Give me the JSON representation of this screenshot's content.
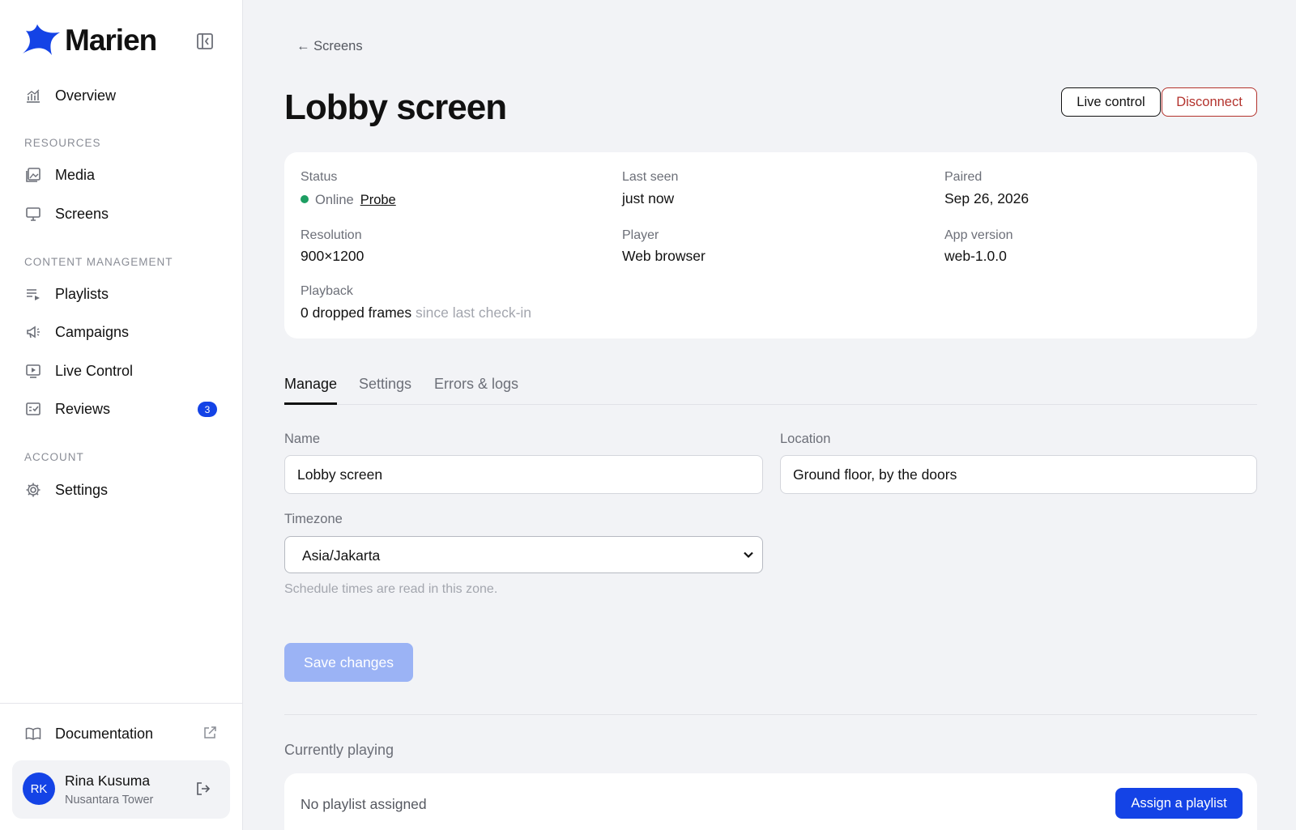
{
  "brand": {
    "name": "Marien",
    "accent": "#1443e6"
  },
  "sidebar": {
    "overview": "Overview",
    "sections": [
      {
        "label": "RESOURCES",
        "items": [
          {
            "label": "Media",
            "icon": "media-icon"
          },
          {
            "label": "Screens",
            "icon": "monitor-icon"
          }
        ]
      },
      {
        "label": "CONTENT MANAGEMENT",
        "items": [
          {
            "label": "Playlists",
            "icon": "playlist-icon"
          },
          {
            "label": "Campaigns",
            "icon": "megaphone-icon"
          },
          {
            "label": "Live Control",
            "icon": "play-screen-icon"
          },
          {
            "label": "Reviews",
            "icon": "checklist-icon",
            "badge": "3"
          }
        ]
      },
      {
        "label": "ACCOUNT",
        "items": [
          {
            "label": "Settings",
            "icon": "gear-icon"
          }
        ]
      }
    ],
    "documentation": "Documentation",
    "user": {
      "initials": "RK",
      "name": "Rina Kusuma",
      "org": "Nusantara Tower"
    }
  },
  "header": {
    "back_label": "← Screens",
    "title": "Lobby screen",
    "live_control": "Live control",
    "disconnect": "Disconnect"
  },
  "info": {
    "status_label": "Status",
    "status_value": "Online",
    "probe": "Probe",
    "last_seen_label": "Last seen",
    "last_seen_value": "just now",
    "paired_label": "Paired",
    "paired_value": "Sep 26, 2026",
    "resolution_label": "Resolution",
    "resolution_value": "900×1200",
    "player_label": "Player",
    "player_value": "Web browser",
    "app_version_label": "App version",
    "app_version_value": "web-1.0.0",
    "playback_label": "Playback",
    "playback_value": "0 dropped frames",
    "playback_suffix": "since last check-in"
  },
  "tabs": [
    "Manage",
    "Settings",
    "Errors & logs"
  ],
  "form": {
    "name_label": "Name",
    "name_value": "Lobby screen",
    "location_label": "Location",
    "location_value": "Ground floor, by the doors",
    "timezone_label": "Timezone",
    "timezone_value": "Asia/Jakarta",
    "timezone_hint": "Schedule times are read in this zone.",
    "save": "Save changes"
  },
  "playing": {
    "title": "Currently playing",
    "empty": "No playlist assigned",
    "assign": "Assign a playlist"
  }
}
